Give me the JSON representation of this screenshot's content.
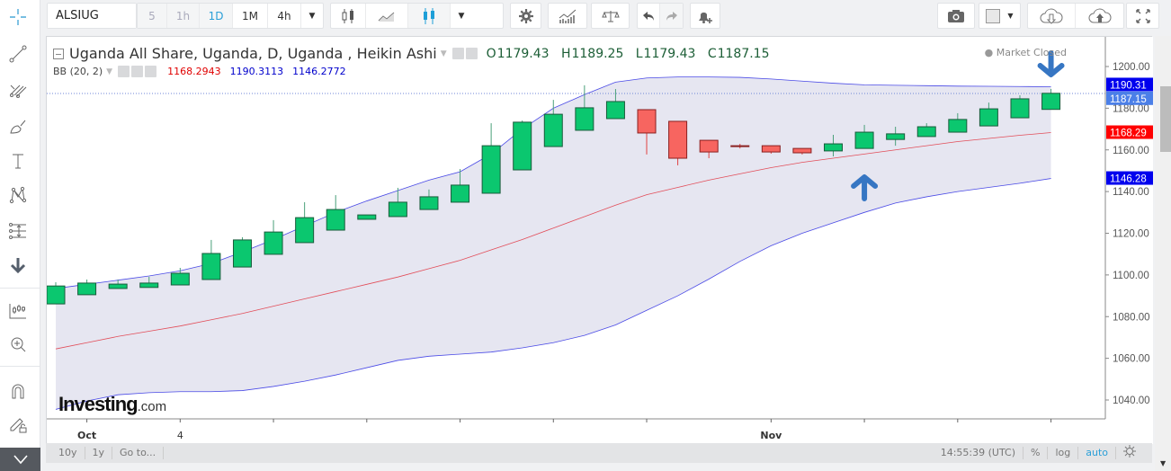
{
  "toolbar": {
    "symbol": "ALSIUG",
    "intervals": [
      {
        "label": "5",
        "state": "dim"
      },
      {
        "label": "1h",
        "state": "dim"
      },
      {
        "label": "1D",
        "state": "active"
      },
      {
        "label": "1M",
        "state": "normal"
      },
      {
        "label": "4h",
        "state": "normal"
      }
    ],
    "icons": [
      "interval-dropdown-icon",
      "bar-chart-type-icon",
      "line-chart-type-icon",
      "candle-chart-type-icon",
      "chart-type-dropdown-icon",
      "settings-icon",
      "indicators-icon",
      "compare-icon",
      "undo-icon",
      "redo-icon",
      "add-alert-icon",
      "snapshot-icon",
      "color-swatch-icon",
      "cloud-download-icon",
      "cloud-upload-icon",
      "fullscreen-icon"
    ]
  },
  "left_tools": [
    "crosshair-icon",
    "trend-line-icon",
    "pitchfork-icon",
    "brush-icon",
    "text-icon",
    "pattern-icon",
    "measure-icon",
    "arrow-down-icon",
    "long-position-icon",
    "zoom-in-icon",
    "magnet-icon",
    "lock-drawing-icon",
    "collapse-icon"
  ],
  "legend": {
    "title": "Uganda All Share, Uganda, D, Uganda , Heikin Ashi",
    "ohlc": {
      "o_label": "O",
      "o": "1179.43",
      "h_label": "H",
      "h": "1189.25",
      "l_label": "L",
      "l": "1179.43",
      "c_label": "C",
      "c": "1187.15"
    },
    "bb_label": "BB (20, 2)",
    "bb_basis": "1168.2943",
    "bb_upper": "1190.3113",
    "bb_lower": "1146.2772",
    "market_status": "Market Closed"
  },
  "bottom": {
    "ranges": [
      "10y",
      "1y",
      "Go to..."
    ],
    "time": "14:55:39 (UTC)",
    "percent": "%",
    "log": "log",
    "auto": "auto"
  },
  "colors": {
    "up": "#0bc76f",
    "down": "#f76560",
    "bb_basis": "#e24d59",
    "bb_band": "#4a4ae6",
    "bb_fill": "#e3e3f0",
    "accent": "#2a9fd8",
    "arrow": "#3676c3"
  },
  "chart_data": {
    "type": "candlestick",
    "title": "Uganda All Share, Uganda, D, Uganda , Heikin Ashi",
    "ylim": [
      1030,
      1208
    ],
    "y_ticks": [
      1040,
      1060,
      1080,
      1100,
      1120,
      1140,
      1160,
      1180,
      1200
    ],
    "y_tick_labels": [
      "1040.00",
      "1060.00",
      "1080.00",
      "1100.00",
      "1120.00",
      "1140.00",
      "1160.00",
      "1180.00",
      "1200.00"
    ],
    "x_tick_labels": [
      {
        "index": 1,
        "label": "Oct"
      },
      {
        "index": 4,
        "label": "4"
      },
      {
        "index": 23,
        "label": "Nov"
      }
    ],
    "x_tick_indices": [
      1,
      4,
      7,
      10,
      13,
      16,
      19,
      23,
      26,
      29,
      32
    ],
    "candles": [
      {
        "o": 1086.1,
        "h": 1096.5,
        "l": 1086.1,
        "c": 1094.7
      },
      {
        "o": 1090.5,
        "h": 1097.8,
        "l": 1090.5,
        "c": 1096.1
      },
      {
        "o": 1093.5,
        "h": 1097.8,
        "l": 1093.5,
        "c": 1095.6
      },
      {
        "o": 1094.0,
        "h": 1099.1,
        "l": 1094.0,
        "c": 1096.1
      },
      {
        "o": 1095.2,
        "h": 1103.4,
        "l": 1095.2,
        "c": 1100.8
      },
      {
        "o": 1097.8,
        "h": 1116.8,
        "l": 1097.8,
        "c": 1110.3
      },
      {
        "o": 1103.8,
        "h": 1118.1,
        "l": 1103.8,
        "c": 1116.8
      },
      {
        "o": 1109.9,
        "h": 1126.3,
        "l": 1109.9,
        "c": 1120.6
      },
      {
        "o": 1115.5,
        "h": 1134.9,
        "l": 1115.5,
        "c": 1127.5
      },
      {
        "o": 1121.5,
        "h": 1138.3,
        "l": 1121.5,
        "c": 1131.4
      },
      {
        "o": 1126.7,
        "h": 1128.8,
        "l": 1126.7,
        "c": 1128.8
      },
      {
        "o": 1128.0,
        "h": 1141.8,
        "l": 1128.0,
        "c": 1134.9
      },
      {
        "o": 1131.4,
        "h": 1141.0,
        "l": 1131.4,
        "c": 1137.5
      },
      {
        "o": 1134.9,
        "h": 1150.8,
        "l": 1134.9,
        "c": 1143.1
      },
      {
        "o": 1139.2,
        "h": 1172.8,
        "l": 1139.2,
        "c": 1162.0
      },
      {
        "o": 1150.4,
        "h": 1174.1,
        "l": 1150.4,
        "c": 1173.3
      },
      {
        "o": 1161.6,
        "h": 1184.0,
        "l": 1161.6,
        "c": 1177.1
      },
      {
        "o": 1169.4,
        "h": 1191.0,
        "l": 1169.4,
        "c": 1180.2
      },
      {
        "o": 1175.0,
        "h": 1189.2,
        "l": 1175.0,
        "c": 1183.2
      },
      {
        "o": 1179.3,
        "h": 1179.3,
        "l": 1157.8,
        "c": 1168.1
      },
      {
        "o": 1173.7,
        "h": 1173.7,
        "l": 1152.6,
        "c": 1156.0
      },
      {
        "o": 1164.6,
        "h": 1164.6,
        "l": 1156.0,
        "c": 1159.0
      },
      {
        "o": 1162.0,
        "h": 1162.9,
        "l": 1160.7,
        "c": 1161.6
      },
      {
        "o": 1162.0,
        "h": 1162.0,
        "l": 1158.2,
        "c": 1159.0
      },
      {
        "o": 1160.7,
        "h": 1160.7,
        "l": 1157.8,
        "c": 1158.6
      },
      {
        "o": 1159.5,
        "h": 1167.2,
        "l": 1156.9,
        "c": 1162.9
      },
      {
        "o": 1160.7,
        "h": 1172.0,
        "l": 1160.7,
        "c": 1168.5
      },
      {
        "o": 1165.0,
        "h": 1171.1,
        "l": 1162.0,
        "c": 1167.7
      },
      {
        "o": 1166.4,
        "h": 1172.8,
        "l": 1166.4,
        "c": 1171.1
      },
      {
        "o": 1168.5,
        "h": 1177.6,
        "l": 1168.5,
        "c": 1174.6
      },
      {
        "o": 1171.5,
        "h": 1182.7,
        "l": 1171.5,
        "c": 1179.7
      },
      {
        "o": 1175.4,
        "h": 1186.2,
        "l": 1175.4,
        "c": 1184.5
      },
      {
        "o": 1179.43,
        "h": 1189.25,
        "l": 1179.43,
        "c": 1187.15
      }
    ],
    "bb_upper": [
      1093.5,
      1095.5,
      1097.5,
      1099.5,
      1102.0,
      1105.5,
      1111.0,
      1117.0,
      1123.5,
      1130.0,
      1135.5,
      1140.5,
      1145.5,
      1149.5,
      1158.0,
      1170.0,
      1180.0,
      1186.5,
      1192.5,
      1194.5,
      1195.0,
      1195.0,
      1194.8,
      1194.0,
      1193.0,
      1192.0,
      1191.2,
      1191.0,
      1190.8,
      1190.6,
      1190.5,
      1190.4,
      1190.31
    ],
    "bb_basis": [
      1064.5,
      1067.5,
      1070.5,
      1073.0,
      1075.5,
      1078.5,
      1081.5,
      1085.0,
      1088.5,
      1092.0,
      1095.5,
      1099.0,
      1103.0,
      1107.0,
      1112.0,
      1117.0,
      1122.5,
      1128.0,
      1133.5,
      1138.5,
      1142.0,
      1145.5,
      1148.5,
      1151.5,
      1154.0,
      1156.0,
      1158.0,
      1160.0,
      1162.0,
      1164.0,
      1165.5,
      1167.0,
      1168.29
    ],
    "bb_lower": [
      1035.5,
      1039.5,
      1042.5,
      1043.5,
      1044.0,
      1044.0,
      1044.5,
      1046.5,
      1049.0,
      1052.0,
      1055.5,
      1059.0,
      1061.0,
      1062.0,
      1063.0,
      1065.0,
      1067.5,
      1071.0,
      1076.0,
      1083.0,
      1090.0,
      1098.0,
      1106.5,
      1114.0,
      1120.0,
      1125.0,
      1130.0,
      1134.5,
      1137.5,
      1140.0,
      1142.0,
      1144.0,
      1146.28
    ],
    "price_labels": [
      {
        "value": 1190.31,
        "label": "1190.31",
        "color": "#0000ee"
      },
      {
        "value": 1187.15,
        "label": "1187.15",
        "color": "#4b7fe8"
      },
      {
        "value": 1168.29,
        "label": "1168.29",
        "color": "#ff0000"
      },
      {
        "value": 1146.28,
        "label": "1146.28",
        "color": "#0000ee"
      }
    ],
    "annotations": [
      {
        "type": "arrow-down",
        "index": 32,
        "text": ""
      },
      {
        "type": "arrow-up",
        "index": 26,
        "text": ""
      }
    ],
    "watermark": "Investing.com"
  }
}
